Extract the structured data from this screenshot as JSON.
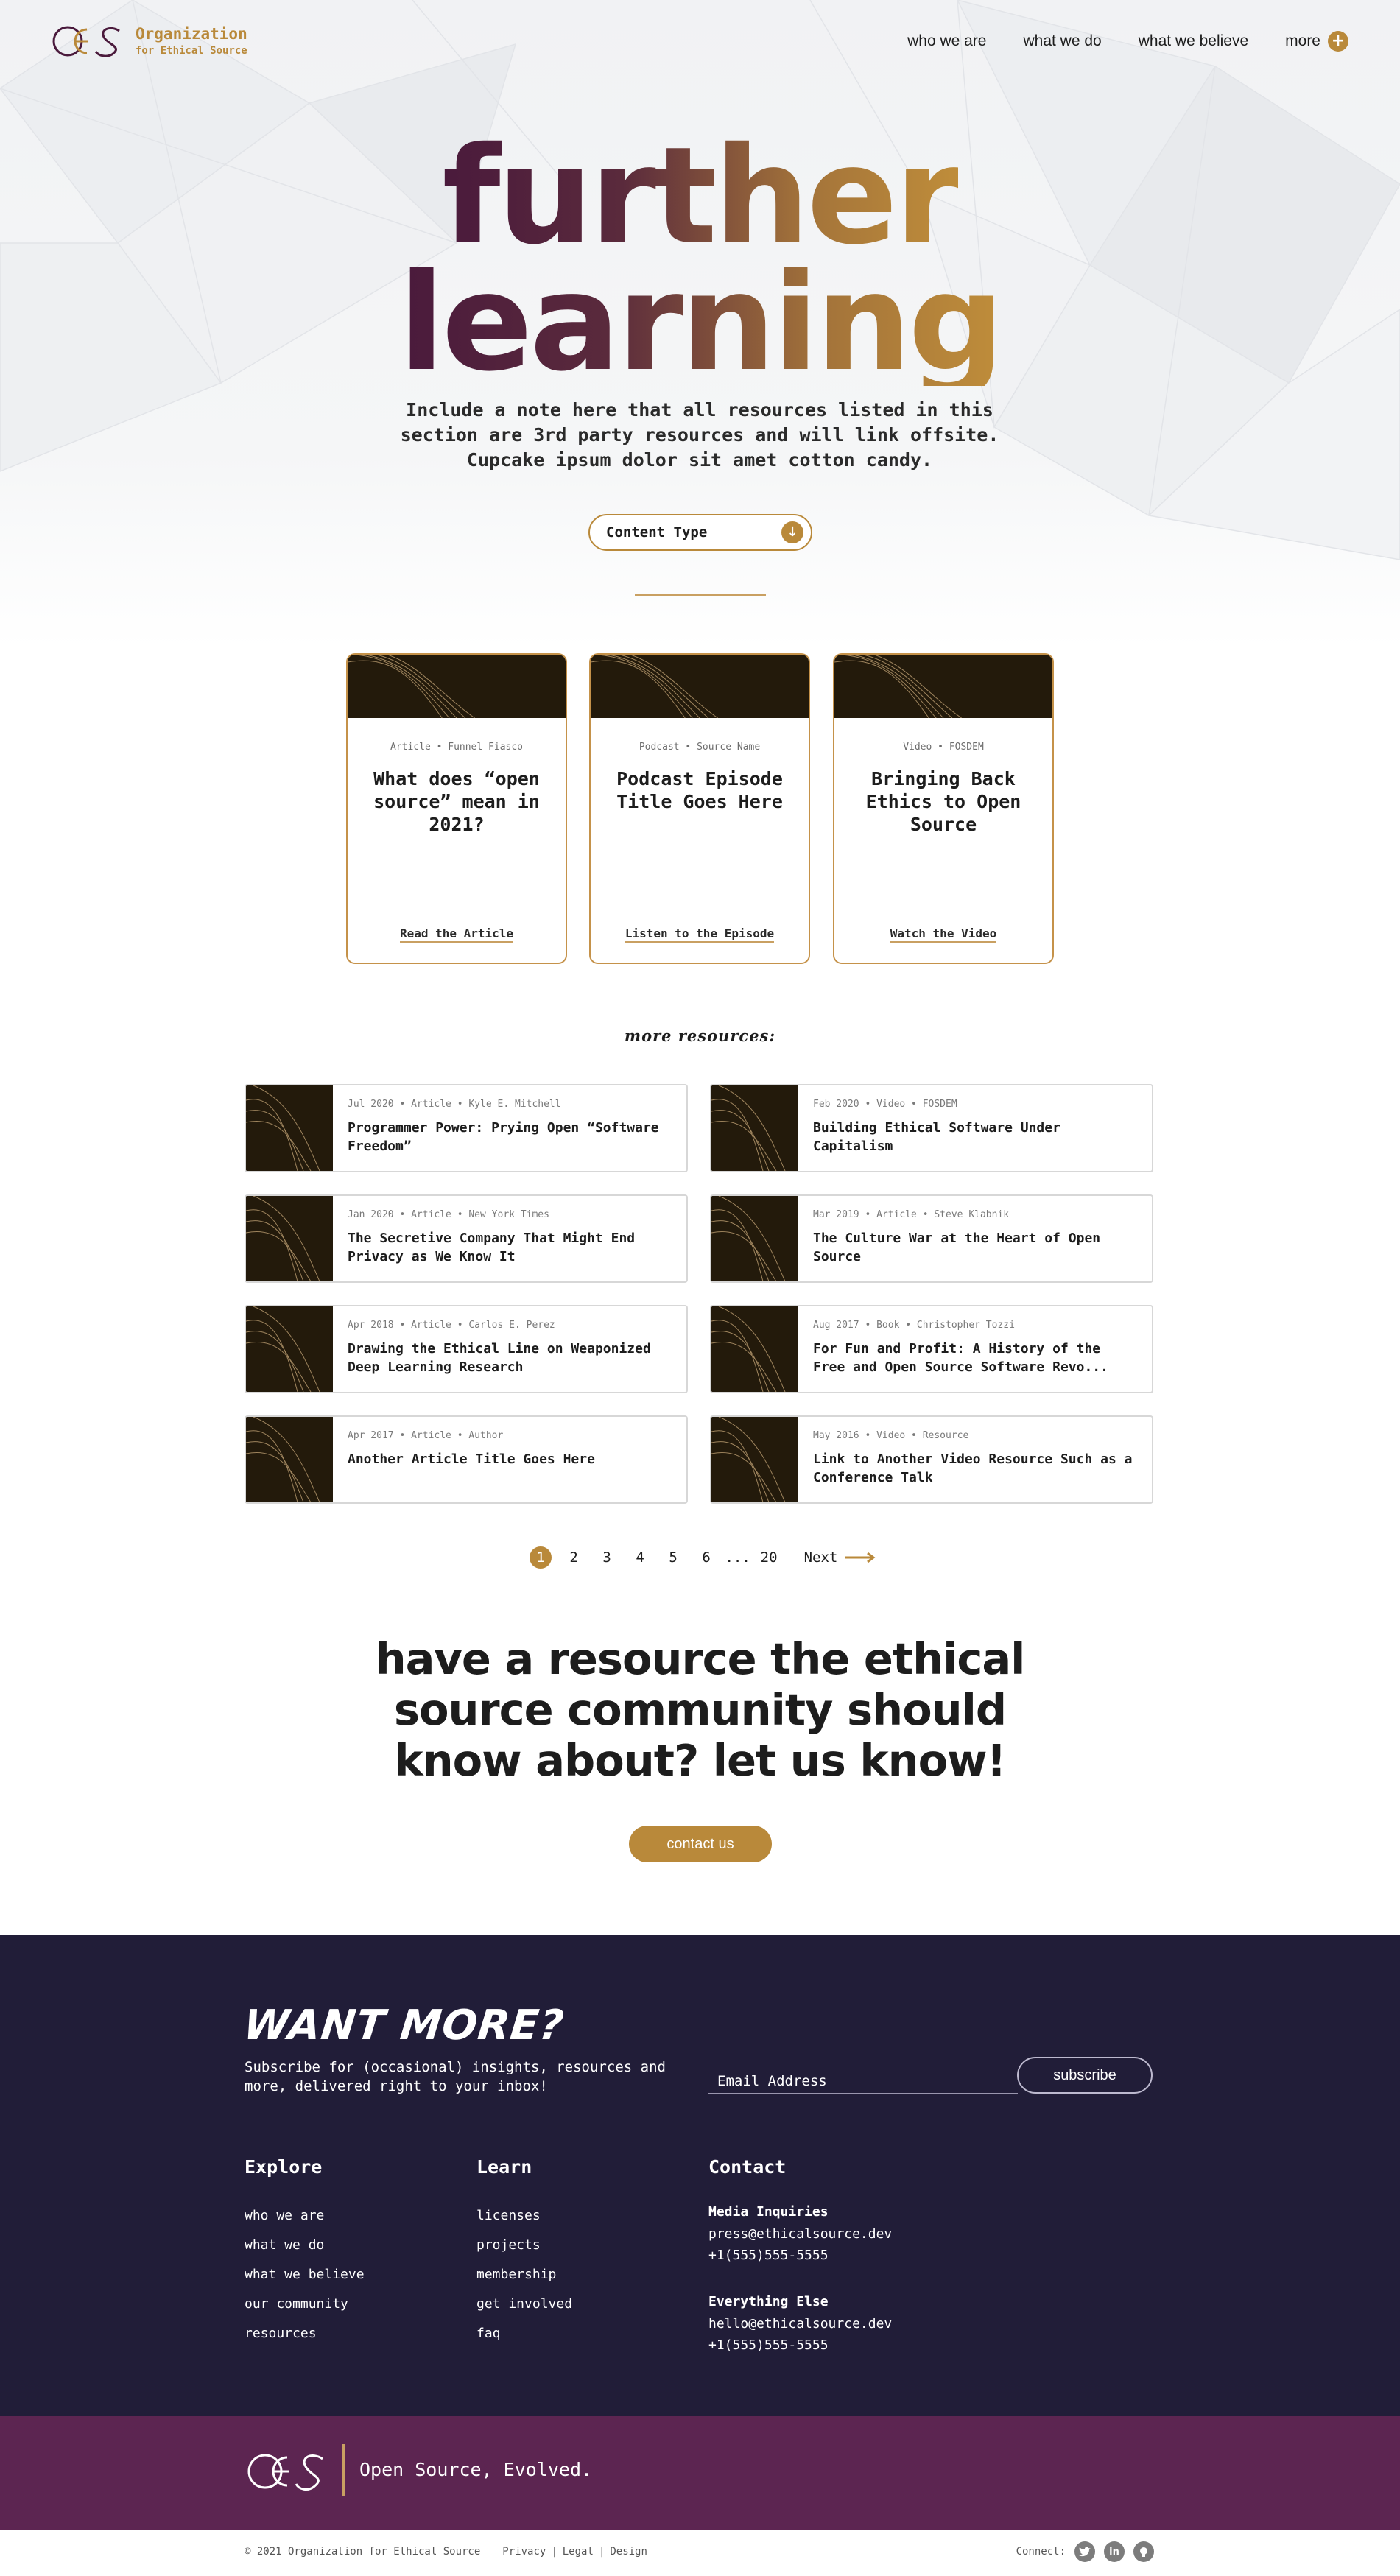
{
  "org": {
    "name_line1": "Organization",
    "name_line2": "for Ethical Source"
  },
  "nav": {
    "items": [
      "who we are",
      "what we do",
      "what we believe"
    ],
    "more_label": "more"
  },
  "hero": {
    "title_line1": "further",
    "title_line2": "learning",
    "subtitle": "Include a note here that all resources listed in this section are 3rd party resources and will link offsite. Cupcake ipsum dolor sit amet cotton candy.",
    "filter_label": "Content Type"
  },
  "featured": [
    {
      "meta": "Article • Funnel Fiasco",
      "title": "What does “open source” mean in 2021?",
      "cta": "Read the Article"
    },
    {
      "meta": "Podcast • Source Name",
      "title": "Podcast Episode Title Goes Here",
      "cta": "Listen to the Episode"
    },
    {
      "meta": "Video • FOSDEM",
      "title": "Bringing Back Ethics to Open Source",
      "cta": "Watch the Video"
    }
  ],
  "more_resources": {
    "heading": "more resources:",
    "items": [
      {
        "meta": "Jul 2020 • Article • Kyle E. Mitchell",
        "title": "Programmer Power: Prying Open “Software Freedom”"
      },
      {
        "meta": "Feb 2020 • Video • FOSDEM",
        "title": "Building Ethical Software Under Capitalism"
      },
      {
        "meta": "Jan 2020 • Article • New York Times",
        "title": "The Secretive Company That Might End Privacy as We Know It"
      },
      {
        "meta": "Mar 2019 • Article • Steve Klabnik",
        "title": "The Culture War at the Heart of Open Source"
      },
      {
        "meta": "Apr 2018 • Article • Carlos E. Perez",
        "title": "Drawing the Ethical Line on Weaponized Deep Learning Research"
      },
      {
        "meta": "Aug 2017 • Book • Christopher Tozzi",
        "title": "For Fun and Profit: A History of the Free and Open Source Software Revo..."
      },
      {
        "meta": "Apr 2017 • Article • Author",
        "title": "Another Article Title Goes Here"
      },
      {
        "meta": "May 2016 • Video • Resource",
        "title": "Link to Another Video Resource Such as a Conference Talk"
      }
    ]
  },
  "pagination": {
    "pages": [
      "1",
      "2",
      "3",
      "4",
      "5",
      "6"
    ],
    "ellipsis": "...",
    "last": "20",
    "next_label": "Next",
    "current": "1"
  },
  "cta": {
    "heading": "have a resource the ethical source community should know about? let us know!",
    "button": "contact us"
  },
  "footer": {
    "want_more": "WANT MORE?",
    "subscribe_text": "Subscribe for (occasional) insights, resources and more, delivered right to your inbox!",
    "email_placeholder": "Email Address",
    "subscribe_button": "subscribe",
    "explore": {
      "heading": "Explore",
      "links": [
        "who we are",
        "what we do",
        "what we believe",
        "our community",
        "resources"
      ]
    },
    "learn": {
      "heading": "Learn",
      "links": [
        "licenses",
        "projects",
        "membership",
        "get involved",
        "faq"
      ]
    },
    "contact": {
      "heading": "Contact",
      "groups": [
        {
          "label": "Media Inquiries",
          "email": "press@ethicalsource.dev",
          "phone": "+1(555)555-5555"
        },
        {
          "label": "Everything Else",
          "email": "hello@ethicalsource.dev",
          "phone": "+1(555)555-5555"
        }
      ]
    },
    "tagline": "Open Source, Evolved.",
    "copyright": "© 2021 Organization for Ethical Source",
    "legal_links": [
      "Privacy",
      "Legal",
      "Design"
    ],
    "connect_label": "Connect:",
    "social_icons": [
      "twitter-icon",
      "linkedin-icon",
      "github-icon"
    ]
  },
  "colors": {
    "gold": "#b9893a",
    "plum": "#4a1a3c",
    "navy": "#211d38",
    "band": "#5c2551"
  }
}
